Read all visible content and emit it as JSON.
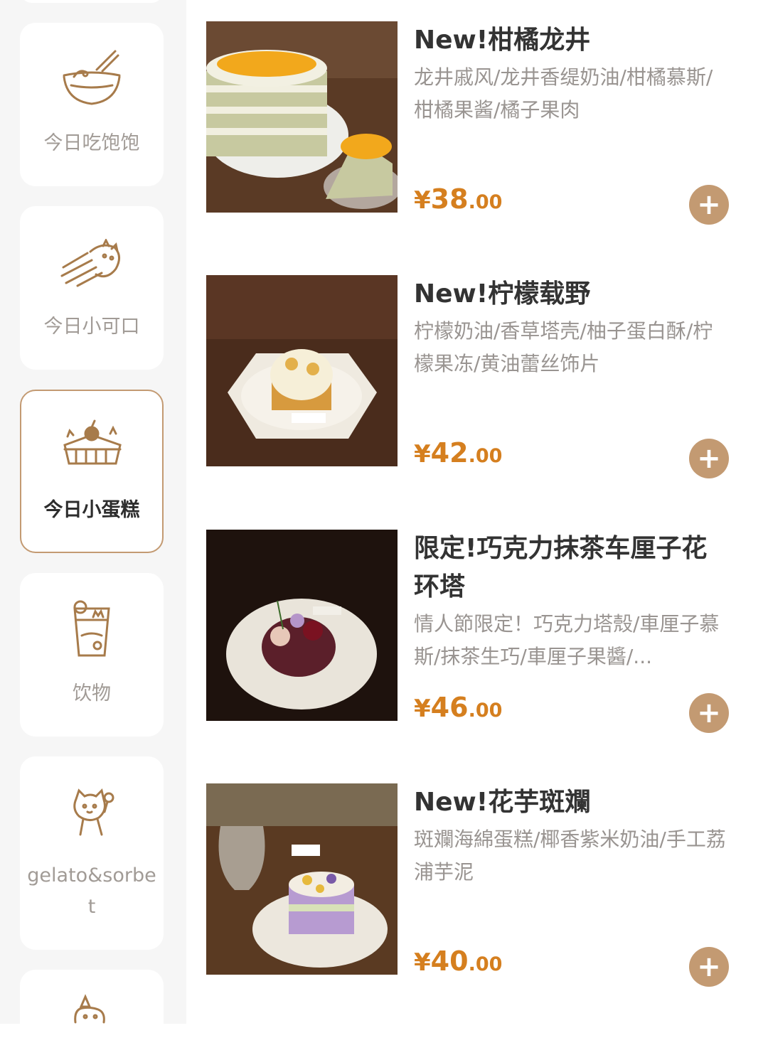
{
  "sidebar": {
    "categories": [
      {
        "label": "今日吃饱饱",
        "icon": "noodle-bowl-cat-icon"
      },
      {
        "label": "今日小可口",
        "icon": "fries-cat-icon"
      },
      {
        "label": "今日小蛋糕",
        "icon": "cake-cat-icon",
        "active": true
      },
      {
        "label": "饮物",
        "icon": "drink-cup-cat-icon"
      },
      {
        "label": "gelato&sorbet",
        "icon": "icecream-cat-icon"
      },
      {
        "label": "",
        "icon": "party-cat-icon"
      }
    ]
  },
  "products": [
    {
      "name": "New!柑橘龙井",
      "desc": "龙井戚风/龙井香缇奶油/柑橘慕斯/柑橘果酱/橘子果肉",
      "currency": "¥",
      "price_int": "38",
      "price_dec": ".00"
    },
    {
      "name": "New!柠檬载野",
      "desc": "柠檬奶油/香草塔壳/柚子蛋白酥/柠檬果冻/黄油蕾丝饰片",
      "currency": "¥",
      "price_int": "42",
      "price_dec": ".00"
    },
    {
      "name": "限定!巧克力抹茶车厘子花环塔",
      "desc": "情人節限定！巧克力塔殼/車厘子慕斯/抹茶生巧/車厘子果醬/...",
      "currency": "¥",
      "price_int": "46",
      "price_dec": ".00"
    },
    {
      "name": "New!花芋斑斕",
      "desc": "斑斕海綿蛋糕/椰香紫米奶油/手工荔浦芋泥",
      "currency": "¥",
      "price_int": "40",
      "price_dec": ".00"
    }
  ],
  "add_button_symbol": "+",
  "colors": {
    "accent": "#c39a72",
    "price": "#d57f1f",
    "sidebar_bg": "#f6f6f6"
  }
}
